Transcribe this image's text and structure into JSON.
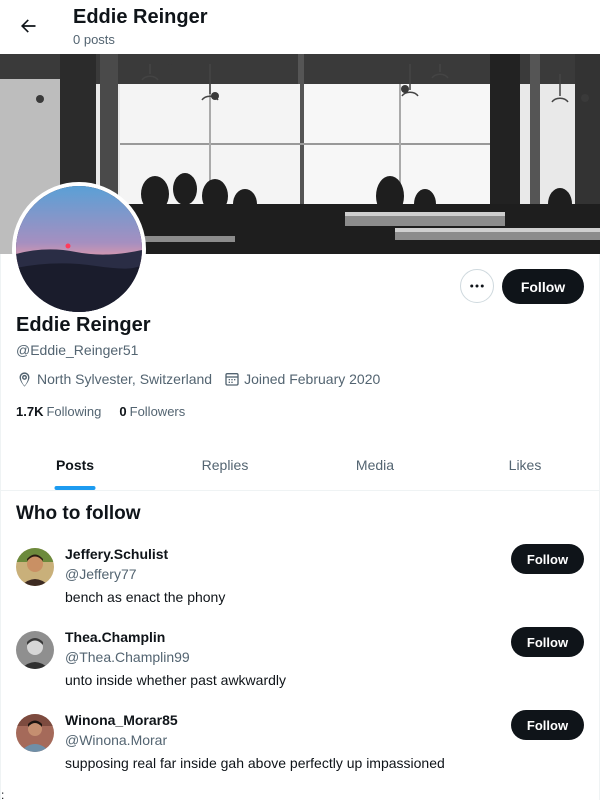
{
  "header": {
    "title": "Eddie Reinger",
    "subtitle": "0 posts",
    "back_icon": "arrow-left-icon"
  },
  "profile": {
    "name": "Eddie Reinger",
    "handle": "@Eddie_Reinger51",
    "location": "North Sylvester, Switzerland",
    "joined": "Joined February 2020",
    "following_count": "1.7K",
    "following_label": "Following",
    "followers_count": "0",
    "followers_label": "Followers",
    "follow_label": "Follow",
    "more_icon": "more-horizontal-icon",
    "location_icon": "location-pin-icon",
    "calendar_icon": "calendar-icon"
  },
  "tabs": [
    {
      "label": "Posts",
      "active": true
    },
    {
      "label": "Replies",
      "active": false
    },
    {
      "label": "Media",
      "active": false
    },
    {
      "label": "Likes",
      "active": false
    }
  ],
  "who_to_follow": {
    "title": "Who to follow",
    "users": [
      {
        "name": "Jeffery.Schulist",
        "handle": "@Jeffery77",
        "bio": "bench as enact the phony",
        "follow_label": "Follow"
      },
      {
        "name": "Thea.Champlin",
        "handle": "@Thea.Champlin99",
        "bio": "unto inside whether past awkwardly",
        "follow_label": "Follow"
      },
      {
        "name": "Winona_Morar85",
        "handle": "@Winona.Morar",
        "bio": "supposing real far inside gah above perfectly up impassioned",
        "follow_label": "Follow"
      }
    ]
  },
  "footer_mark": ":",
  "colors": {
    "accent": "#1d9bf0",
    "button_dark": "#0f1419",
    "secondary_text": "#536471"
  }
}
